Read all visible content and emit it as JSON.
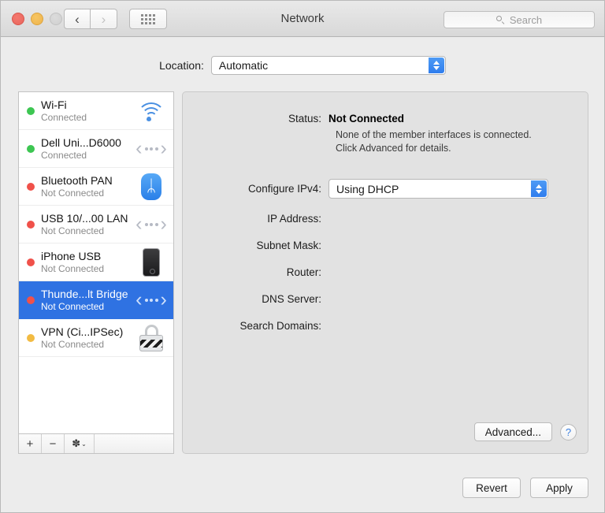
{
  "window": {
    "title": "Network",
    "traffic_lights": [
      "close",
      "minimize",
      "zoom"
    ],
    "nav_back": "‹",
    "nav_forward": "›"
  },
  "search": {
    "placeholder": "Search",
    "value": ""
  },
  "location": {
    "label": "Location:",
    "value": "Automatic"
  },
  "sidebar": {
    "services": [
      {
        "name": "Wi-Fi",
        "state": "Connected",
        "status_color": "#3dc652",
        "icon": "wifi-icon",
        "selected": false
      },
      {
        "name": "Dell Uni...D6000",
        "state": "Connected",
        "status_color": "#3dc652",
        "icon": "ethernet-icon",
        "selected": false
      },
      {
        "name": "Bluetooth PAN",
        "state": "Not Connected",
        "status_color": "#f0514a",
        "icon": "bluetooth-icon",
        "selected": false
      },
      {
        "name": "USB 10/...00 LAN",
        "state": "Not Connected",
        "status_color": "#f0514a",
        "icon": "ethernet-icon",
        "selected": false
      },
      {
        "name": "iPhone USB",
        "state": "Not Connected",
        "status_color": "#f0514a",
        "icon": "iphone-icon",
        "selected": false
      },
      {
        "name": "Thunde...lt Bridge",
        "state": "Not Connected",
        "status_color": "#f0514a",
        "icon": "ethernet-icon",
        "selected": true
      },
      {
        "name": "VPN (Ci...IPSec)",
        "state": "Not Connected",
        "status_color": "#f2bb42",
        "icon": "lock-icon",
        "selected": false
      }
    ],
    "footer": {
      "add": "+",
      "remove": "−",
      "gear": "✽",
      "gear_chevron": "⌄"
    }
  },
  "detail": {
    "status_label": "Status:",
    "status_value": "Not Connected",
    "status_help_line1": "None of the member interfaces is connected.",
    "status_help_line2": "Click Advanced for details.",
    "configure_label": "Configure IPv4:",
    "configure_value": "Using DHCP",
    "fields": [
      {
        "label": "IP Address:",
        "value": ""
      },
      {
        "label": "Subnet Mask:",
        "value": ""
      },
      {
        "label": "Router:",
        "value": ""
      },
      {
        "label": "DNS Server:",
        "value": ""
      },
      {
        "label": "Search Domains:",
        "value": ""
      }
    ],
    "advanced_label": "Advanced...",
    "help_label": "?"
  },
  "footer": {
    "revert_label": "Revert",
    "apply_label": "Apply"
  },
  "colors": {
    "selection_blue": "#2f72e2",
    "accent_blue": "#2f7ded",
    "connected_green": "#3dc652",
    "disconnected_red": "#f0514a",
    "warning_yellow": "#f2bb42"
  }
}
